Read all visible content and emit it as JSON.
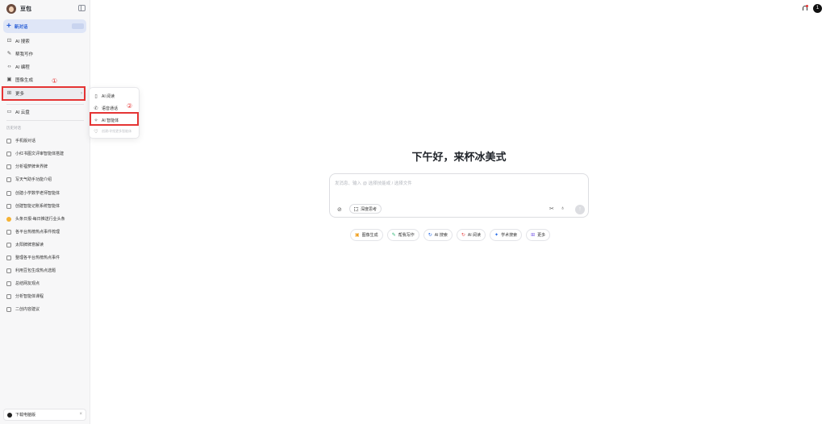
{
  "app": {
    "name": "豆包"
  },
  "sidebar": {
    "new_chat": "新对话",
    "nav": [
      {
        "label": "AI 搜索",
        "icon": "search-icon"
      },
      {
        "label": "帮我写作",
        "icon": "pen-icon"
      },
      {
        "label": "AI 编程",
        "icon": "code-icon"
      },
      {
        "label": "图像生成",
        "icon": "image-icon"
      },
      {
        "label": "更多",
        "icon": "grid-icon"
      },
      {
        "label": "AI 云盘",
        "icon": "cloud-drive-icon"
      }
    ],
    "history_label": "历史对话",
    "history": [
      "手机版对话",
      "小红书图文评审智能体搭建",
      "分析福萝牌世界牌",
      "写天气助手功能介绍",
      "创建小学数学老师智能体",
      "创建智能记账系统智能体",
      "头条日报-每日推送行业头条",
      "各平台热榜热点事件梳理",
      "太阳牌牌意解读",
      "整理各平台热榜热点事件",
      "利用豆包生成热点选题",
      "总结网友观点",
      "分析智能体课程",
      "二创内容建议"
    ],
    "download": "下载电脑版"
  },
  "annotations": {
    "step1": "①",
    "step2": "②",
    "color": "#e53434"
  },
  "popup": {
    "items": [
      {
        "label": "AI 阅读",
        "icon": "book-icon"
      },
      {
        "label": "语音通话",
        "icon": "phone-icon"
      },
      {
        "label": "AI 智能体",
        "icon": "sparkle-icon"
      },
      {
        "label": "创建/寻找更多智能体",
        "icon": "bulb-icon"
      }
    ]
  },
  "header": {
    "user_initial": "1"
  },
  "main": {
    "greeting": "下午好，来杯冰美式",
    "input_placeholder": "发消息、输入 @ 选择技能或 / 选择文件",
    "deep_think": "深度思考",
    "chips": [
      {
        "label": "图像生成",
        "icon": "image-icon",
        "color": "#f0a020"
      },
      {
        "label": "帮我写作",
        "icon": "pen-icon",
        "color": "#2bb673"
      },
      {
        "label": "AI 搜索",
        "icon": "search-icon",
        "color": "#2a6ee8"
      },
      {
        "label": "AI 阅读",
        "icon": "book-icon",
        "color": "#e84a4a"
      },
      {
        "label": "学术搜索",
        "icon": "academic-icon",
        "color": "#2a6ee8"
      },
      {
        "label": "更多",
        "icon": "grid-icon",
        "color": "#7a5ce8"
      }
    ]
  },
  "colors": {
    "accent": "#2a5fd6",
    "sidebar_bg": "#f7f7f8"
  }
}
